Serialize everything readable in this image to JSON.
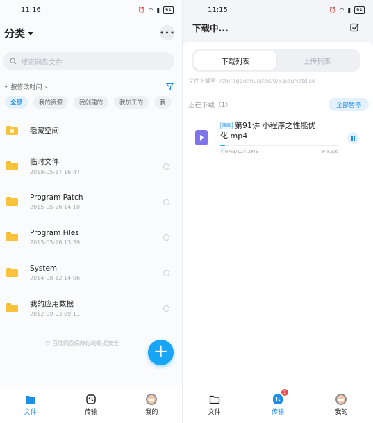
{
  "left": {
    "status": {
      "time": "11:16",
      "battery": "61"
    },
    "header": {
      "title": "分类",
      "more_icon": "more-icon"
    },
    "search": {
      "placeholder": "搜索网盘文件"
    },
    "sort": {
      "label": "按修改时间"
    },
    "chips": [
      "全部",
      "我的资源",
      "我创建的",
      "我加工的",
      "我"
    ],
    "files": [
      {
        "name": "隐藏空间",
        "date": "",
        "locked": true
      },
      {
        "name": "临时文件",
        "date": "2018-05-17  16:47"
      },
      {
        "name": "Program Patch",
        "date": "2015-05-26  14:10"
      },
      {
        "name": "Program Files",
        "date": "2015-05-26  13:59"
      },
      {
        "name": "System",
        "date": "2014-08-12  14:06"
      },
      {
        "name": "我的应用数据",
        "date": "2012-09-03  09:11"
      }
    ],
    "safety": "百度网盘保障你的数据安全",
    "nav": [
      {
        "label": "文件",
        "icon": "folder-icon",
        "active": true
      },
      {
        "label": "传输",
        "icon": "transfer-icon",
        "active": false
      },
      {
        "label": "我的",
        "icon": "avatar-icon",
        "active": false
      }
    ]
  },
  "right": {
    "status": {
      "time": "11:15",
      "battery": "61"
    },
    "header": {
      "title": "下载中..."
    },
    "tabs": [
      "下载列表",
      "上传列表"
    ],
    "path": "文件下载至: /storage/emulated/0/BaiduNetdisk",
    "section_title": "正在下载（1）",
    "pause_all": "全部暂停",
    "task": {
      "tag": "原画",
      "name": "第91讲 小程序之性能优化.mp4",
      "size": "4.9MB/127.2MB",
      "speed": "84KB/s",
      "progress": 0.04
    },
    "nav": [
      {
        "label": "文件",
        "icon": "folder-outline-icon",
        "active": false
      },
      {
        "label": "传输",
        "icon": "transfer-icon",
        "active": true,
        "badge": "1"
      },
      {
        "label": "我的",
        "icon": "avatar-icon",
        "active": false
      }
    ]
  }
}
